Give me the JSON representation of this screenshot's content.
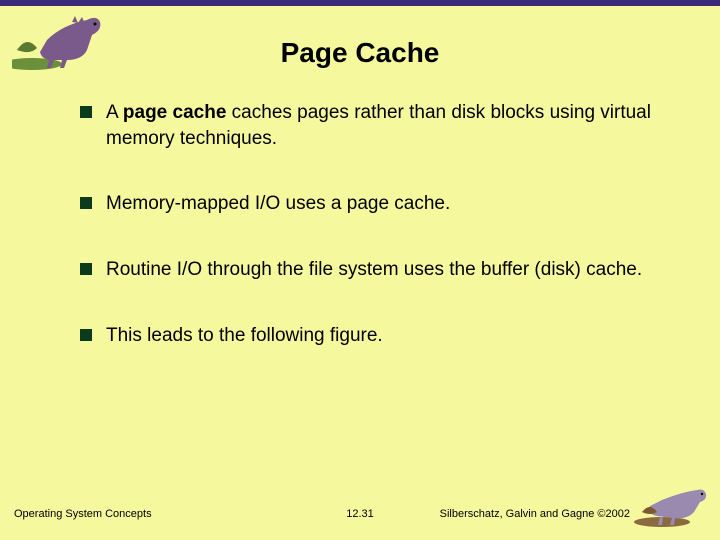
{
  "title": "Page Cache",
  "bullets": [
    {
      "prefix": "A ",
      "bold": "page cache",
      "rest": " caches pages rather than disk blocks using virtual memory techniques."
    },
    {
      "prefix": "",
      "bold": "",
      "rest": "Memory-mapped I/O uses a page cache."
    },
    {
      "prefix": "",
      "bold": "",
      "rest": "Routine I/O through the file system uses the buffer (disk) cache."
    },
    {
      "prefix": "",
      "bold": "",
      "rest": "This leads to the following figure."
    }
  ],
  "footer": {
    "left": "Operating System Concepts",
    "center": "12.31",
    "right": "Silberschatz, Galvin and Gagne ©2002"
  },
  "icons": {
    "dino_top": "dinosaur-corner-illustration",
    "dino_bottom": "dinosaur-corner-illustration"
  }
}
